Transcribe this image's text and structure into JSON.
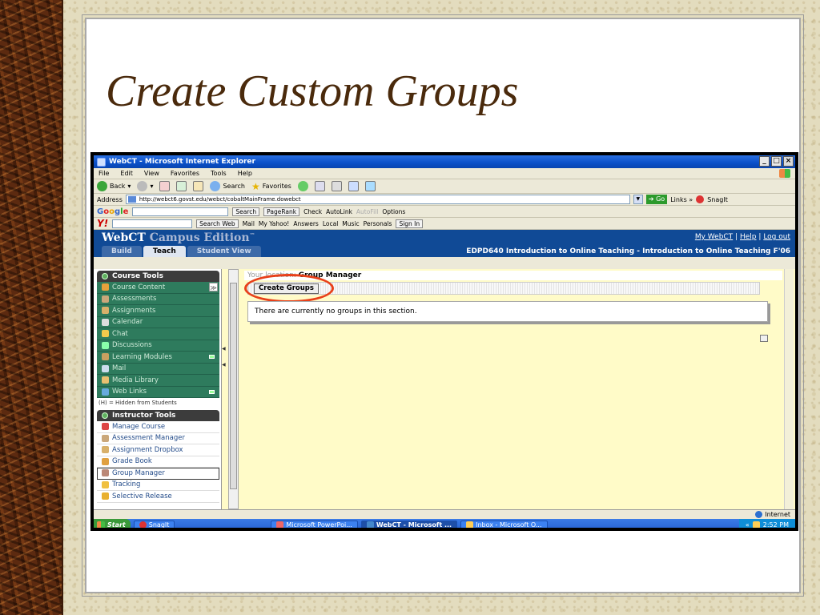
{
  "slide": {
    "title": "Create Custom Groups"
  },
  "window": {
    "title": "WebCT - Microsoft Internet Explorer",
    "buttons": [
      "_",
      "□",
      "×"
    ]
  },
  "menu": [
    "File",
    "Edit",
    "View",
    "Favorites",
    "Tools",
    "Help"
  ],
  "toolbar": {
    "back": "Back",
    "search": "Search",
    "favorites": "Favorites"
  },
  "address": {
    "label": "Address",
    "url": "http://webct6.govst.edu/webct/cobaltMainFrame.dowebct",
    "go": "Go",
    "links": "Links",
    "snagit": "SnagIt"
  },
  "google_bar": {
    "logo_parts": [
      "G",
      "o",
      "o",
      "g",
      "l",
      "e"
    ],
    "search": "Search",
    "pagerank": "PageRank",
    "check": "Check",
    "autolink": "AutoLink",
    "autofill": "AutoFill",
    "options": "Options"
  },
  "yahoo_bar": {
    "logo": "Y!",
    "search_web": "Search Web",
    "mail": "Mail",
    "my_yahoo": "My Yahoo!",
    "answers": "Answers",
    "local": "Local",
    "music": "Music",
    "personals": "Personals",
    "sign_in": "Sign In"
  },
  "webct": {
    "brand_1": "WebCT",
    "brand_2": "Campus Edition",
    "tm": "™",
    "links": {
      "my_webct": "My WebCT",
      "help": "Help",
      "logout": "Log out",
      "sep": "|"
    },
    "tabs": [
      "Build",
      "Teach",
      "Student View"
    ],
    "course": "EDPD640 Introduction to Online Teaching - Introduction to Online Teaching F'06"
  },
  "course_tools": {
    "header": "Course Tools",
    "items": [
      "Course Content",
      "Assessments",
      "Assignments",
      "Calendar",
      "Chat",
      "Discussions",
      "Learning Modules",
      "Mail",
      "Media Library",
      "Web Links"
    ],
    "note": "(H) = Hidden from Students"
  },
  "instructor_tools": {
    "header": "Instructor Tools",
    "items": [
      "Manage Course",
      "Assessment Manager",
      "Assignment Dropbox",
      "Grade Book",
      "Group Manager",
      "Tracking",
      "Selective Release"
    ]
  },
  "content": {
    "location_label": "Your location:",
    "location_current": "Group Manager",
    "create_button": "Create Groups",
    "empty_message": "There are currently no groups in this section."
  },
  "statusbar": {
    "zone": "Internet"
  },
  "taskbar": {
    "start": "Start",
    "tasks": [
      "SnagIt",
      "Microsoft PowerPoi...",
      "WebCT - Microsoft ...",
      "Inbox - Microsoft O..."
    ],
    "time": "2:52 PM"
  }
}
